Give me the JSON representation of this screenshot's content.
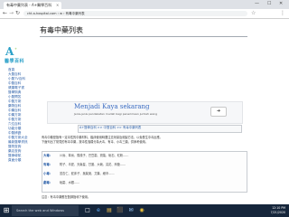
{
  "browser": {
    "tab_title": "有毒中藥列表 - A+醫學百科",
    "address": "cht.a-hospital.com › w › 有毒中藥列表",
    "window_controls": {
      "minimize": "—",
      "maximize": "☐",
      "close": "✕"
    },
    "nav_icons": {
      "back": "←",
      "forward": "→",
      "reload": "↻",
      "star": "☆",
      "menu": "⋮"
    },
    "tab_close": "×"
  },
  "sidebar": {
    "logo_letter": "A",
    "logo_small": "+",
    "logo_text": "醫學百科",
    "items": [
      {
        "label": "首頁"
      },
      {
        "label": "大醫百科"
      },
      {
        "label": "小醫TV百科"
      },
      {
        "label": "中醫百科"
      },
      {
        "label": "健康電子書"
      },
      {
        "label": "醫學詞典"
      },
      {
        "label": "小醫問答"
      },
      {
        "label": "中醫方劑"
      },
      {
        "label": "藥物百科"
      },
      {
        "label": "中藥百科"
      },
      {
        "label": "中藥方劑"
      },
      {
        "label": "中醫方劑"
      },
      {
        "label": "穴位百科"
      },
      {
        "label": "功能分類"
      },
      {
        "label": "中醫辨證"
      },
      {
        "label": "中醫方劑大全"
      },
      {
        "label": "最新醫學資訊"
      },
      {
        "label": "醫院查詢"
      },
      {
        "label": "藥店查詢"
      },
      {
        "label": "醫療導航"
      },
      {
        "label": "頁面分類"
      }
    ]
  },
  "article": {
    "title": "有毒中藥列表",
    "ad": {
      "title": "Menjadi Kaya sekarang",
      "subtitle": "Jenis-jenis pendekatan mudah bagi penerimaan jumlah wang",
      "button": "➜"
    },
    "breadcrumb": "A+醫學百科 >> 中醫百科 >> 有毒中藥列表",
    "paragraphs": [
      "有毒中藥是指有一定毒性的中藥材料，臨床使用時要注意劑量及炮製方法，以免發生中毒反應。",
      "下面列出了常見的有毒中藥，按毒性強弱分為大毒、有毒、小毒三類，供參考使用。"
    ],
    "rows": [
      {
        "head": "大毒：",
        "text": "川烏、草烏、馬錢子、巴豆霜、斑蝥、砒石、紅粉……"
      },
      {
        "head": "有毒：",
        "text": "附子、半夏、天南星、甘遂、大戟、芫花、商陸……"
      },
      {
        "head": "小毒：",
        "text": "苦杏仁、蛇床子、吳茱萸、艾葉、細辛……"
      },
      {
        "head": "劇毒：",
        "text": "砒霜、水銀……"
      }
    ],
    "bottom_text": "注意：有毒中藥應在醫師指導下使用。"
  },
  "taskbar": {
    "start_icon": "⊞",
    "search_placeholder": "Search the web and Windows",
    "icons": [
      "□",
      "e",
      "▤",
      "⬛",
      "✉",
      "◉"
    ],
    "time": "12:10 PM",
    "date": "7/21/2020"
  }
}
